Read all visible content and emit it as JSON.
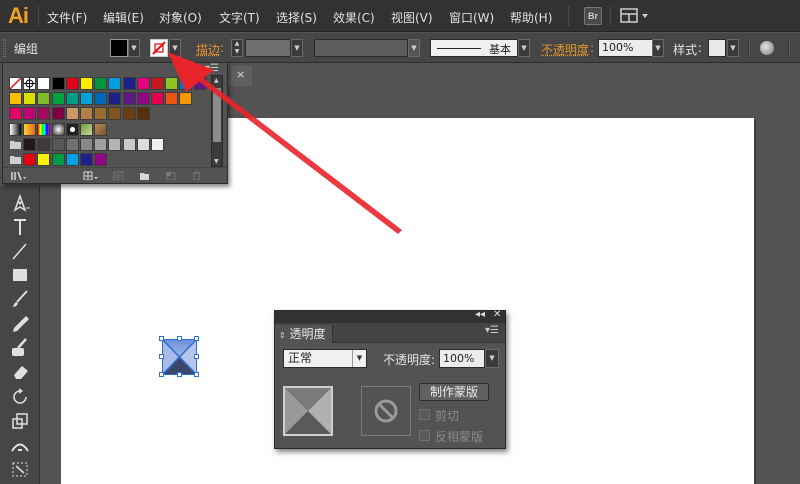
{
  "app": {
    "logo": "Ai"
  },
  "menubar": {
    "items": [
      "文件(F)",
      "编辑(E)",
      "对象(O)",
      "文字(T)",
      "选择(S)",
      "效果(C)",
      "视图(V)",
      "窗口(W)",
      "帮助(H)"
    ],
    "bridge_label": "Br"
  },
  "controlbar": {
    "selection_type": "编组",
    "stroke_label": "描边",
    "stroke_profile": "基本",
    "opacity_label": "不透明度",
    "opacity_value": "100%",
    "style_label": "样式"
  },
  "swatches": {
    "rows": [
      [
        "special-none",
        "special-reg",
        "#ffffff",
        "#000000",
        "#e2001a",
        "#ffec00",
        "#00963f",
        "#009ee0",
        "#1d2088",
        "#e4007f",
        "#c8161d",
        "#8fc31f",
        "#0075c2",
        "#601986"
      ],
      [
        "#fabe00",
        "#dce000",
        "#7dbd2a",
        "#00a23c",
        "#009d86",
        "#00a2d8",
        "#0068b7",
        "#1d2087",
        "#5f1985",
        "#920783",
        "#e5004f",
        "#ea5514",
        "#f39800"
      ],
      [
        "#e60065",
        "#c40076",
        "#a40b5d",
        "#7e0044",
        "#cc9966",
        "#b48144",
        "#9c6b30",
        "#825420",
        "#6b3f10",
        "#57300a"
      ],
      [
        "grad-wb",
        "grad-or",
        "grad-rainbow",
        "grad-bw2",
        "pat-dots",
        "pat-leaf",
        "pat-wood"
      ],
      [
        "folder",
        "#231815",
        "#3e3a39",
        "#595757",
        "#727171",
        "#898989",
        "#9fa0a0",
        "#b5b5b6",
        "#c9caca",
        "#dcdddd",
        "#efefef"
      ],
      [
        "folder",
        "#e60012",
        "#fff100",
        "#009944",
        "#00a0e9",
        "#1d2088",
        "#920783"
      ]
    ]
  },
  "tab": {
    "close": "×"
  },
  "transparency": {
    "title": "透明度",
    "blend_mode": "正常",
    "opacity_label": "不透明度",
    "opacity_value": "100%",
    "make_mask": "制作蒙版",
    "clip": "剪切",
    "invert": "反相蒙版"
  }
}
